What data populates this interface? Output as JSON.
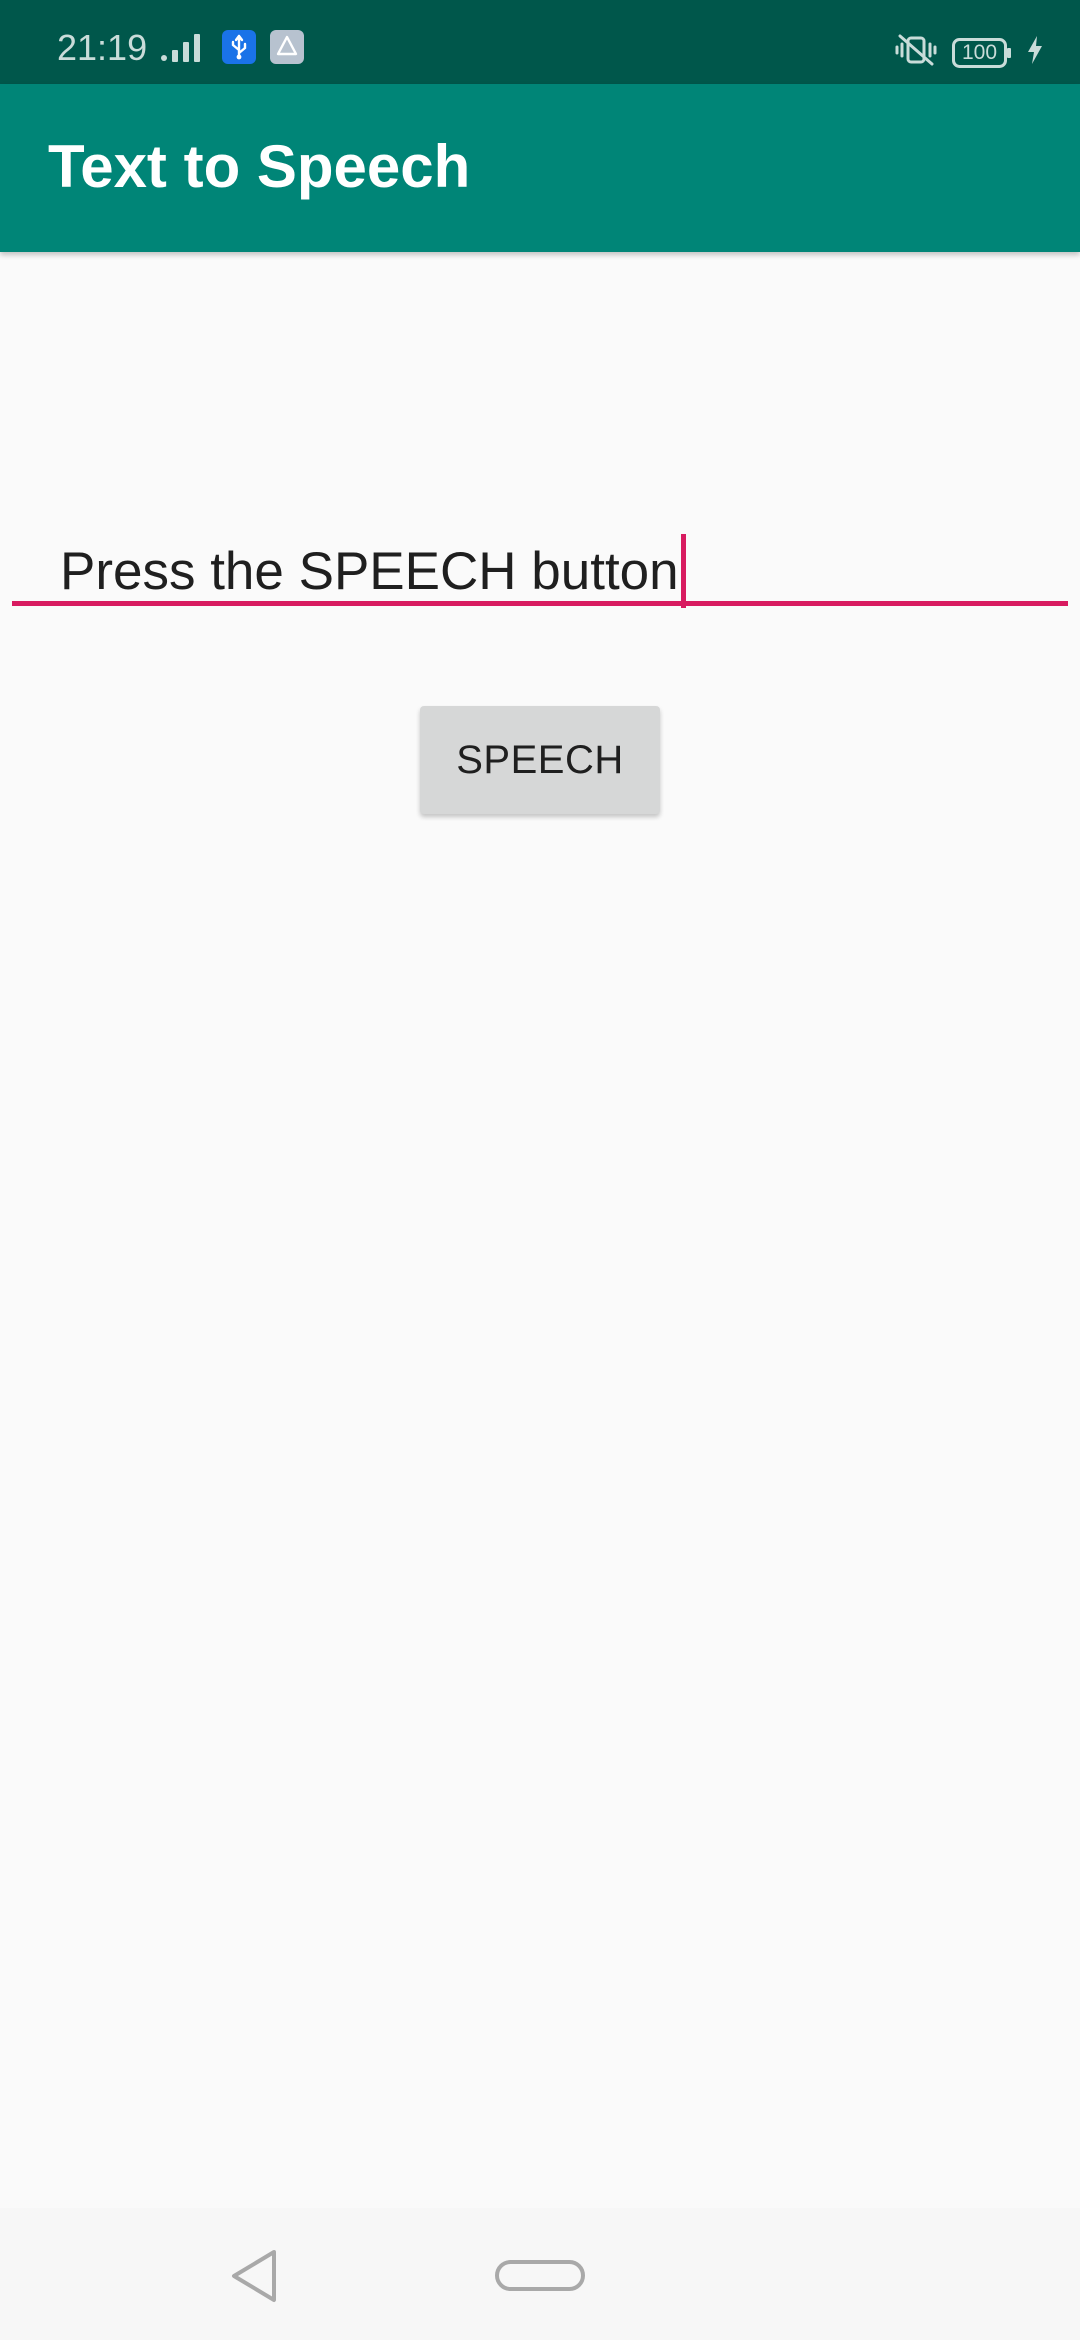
{
  "status_bar": {
    "time": "21:19",
    "left_icons": [
      "signal-icon",
      "usb-icon",
      "drive-icon"
    ],
    "right_icons": [
      "vibrate-off-icon",
      "battery-icon",
      "charging-icon"
    ],
    "battery_level": "100"
  },
  "app_bar": {
    "title": "Text to Speech",
    "color": "#008577"
  },
  "input": {
    "value": "Press the SPEECH button",
    "accent_color": "#d81b60"
  },
  "button": {
    "label": "SPEECH"
  },
  "nav_bar": {
    "icons": [
      "back-icon",
      "home-icon"
    ]
  }
}
